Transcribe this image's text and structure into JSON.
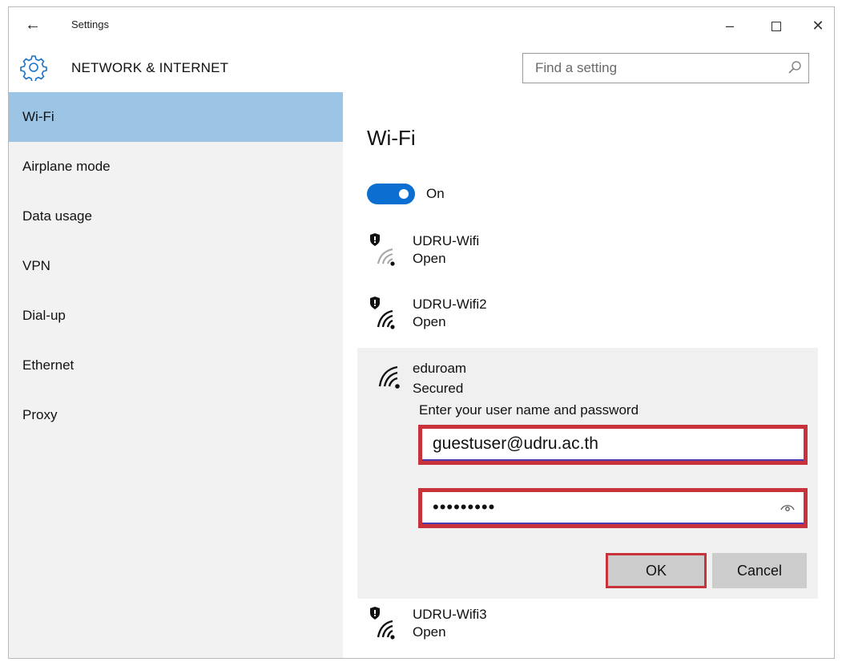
{
  "window": {
    "title": "Settings",
    "minimize_glyph": "–",
    "close_glyph": "✕",
    "back_glyph": "←"
  },
  "header": {
    "section_title": "NETWORK & INTERNET",
    "search_placeholder": "Find a setting"
  },
  "sidebar": {
    "items": [
      {
        "label": "Wi-Fi",
        "active": true
      },
      {
        "label": "Airplane mode",
        "active": false
      },
      {
        "label": "Data usage",
        "active": false
      },
      {
        "label": "VPN",
        "active": false
      },
      {
        "label": "Dial-up",
        "active": false
      },
      {
        "label": "Ethernet",
        "active": false
      },
      {
        "label": "Proxy",
        "active": false
      }
    ]
  },
  "main": {
    "title": "Wi-Fi",
    "toggle_label": "On",
    "toggle_on": true,
    "networks": [
      {
        "name": "UDRU-Wifi",
        "status": "Open",
        "icon": "wifi-shield-weak-icon"
      },
      {
        "name": "UDRU-Wifi2",
        "status": "Open",
        "icon": "wifi-shield-icon"
      },
      {
        "name": "UDRU-Wifi3",
        "status": "Open",
        "icon": "wifi-shield-icon"
      }
    ],
    "expanded": {
      "name": "eduroam",
      "status": "Secured",
      "prompt": "Enter your user name and password",
      "username": "guestuser@udru.ac.th",
      "password": "•••••••••",
      "ok_label": "OK",
      "cancel_label": "Cancel"
    }
  },
  "colors": {
    "accent": "#0a6fd0",
    "sidebar_active": "#9cc4e4",
    "highlight_border": "#c8323b"
  }
}
